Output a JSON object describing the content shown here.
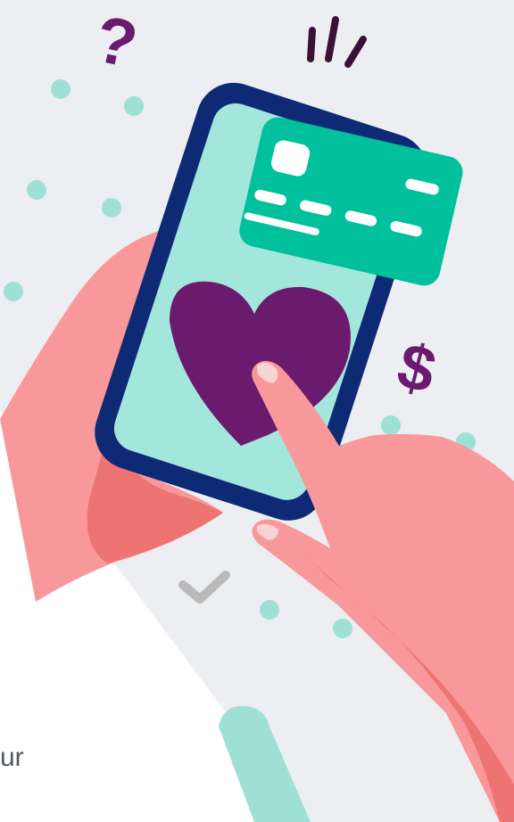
{
  "illustration": {
    "symbols": {
      "question_mark": "?",
      "dollar_sign": "$"
    },
    "partial_text": "ur"
  },
  "colors": {
    "background_panel": "#eceef1",
    "page_white": "#ffffff",
    "phone_frame": "#0f2a75",
    "phone_screen": "#a3e6dc",
    "card": "#00c19c",
    "card_chip": "#ffffff",
    "heart": "#6a1b6e",
    "skin": "#f9989a",
    "skin_shadow": "#ee7474",
    "nail": "#f8d4d5",
    "accent_purple": "#6a1b6e",
    "dots": "#9fe0d4",
    "check": "#b9b9b9",
    "sparkle": "#3a1037"
  },
  "icons": [
    "question-mark-icon",
    "sparkle-lines-icon",
    "dollar-sign-icon",
    "checkmark-icon",
    "credit-card-icon",
    "heart-icon"
  ]
}
